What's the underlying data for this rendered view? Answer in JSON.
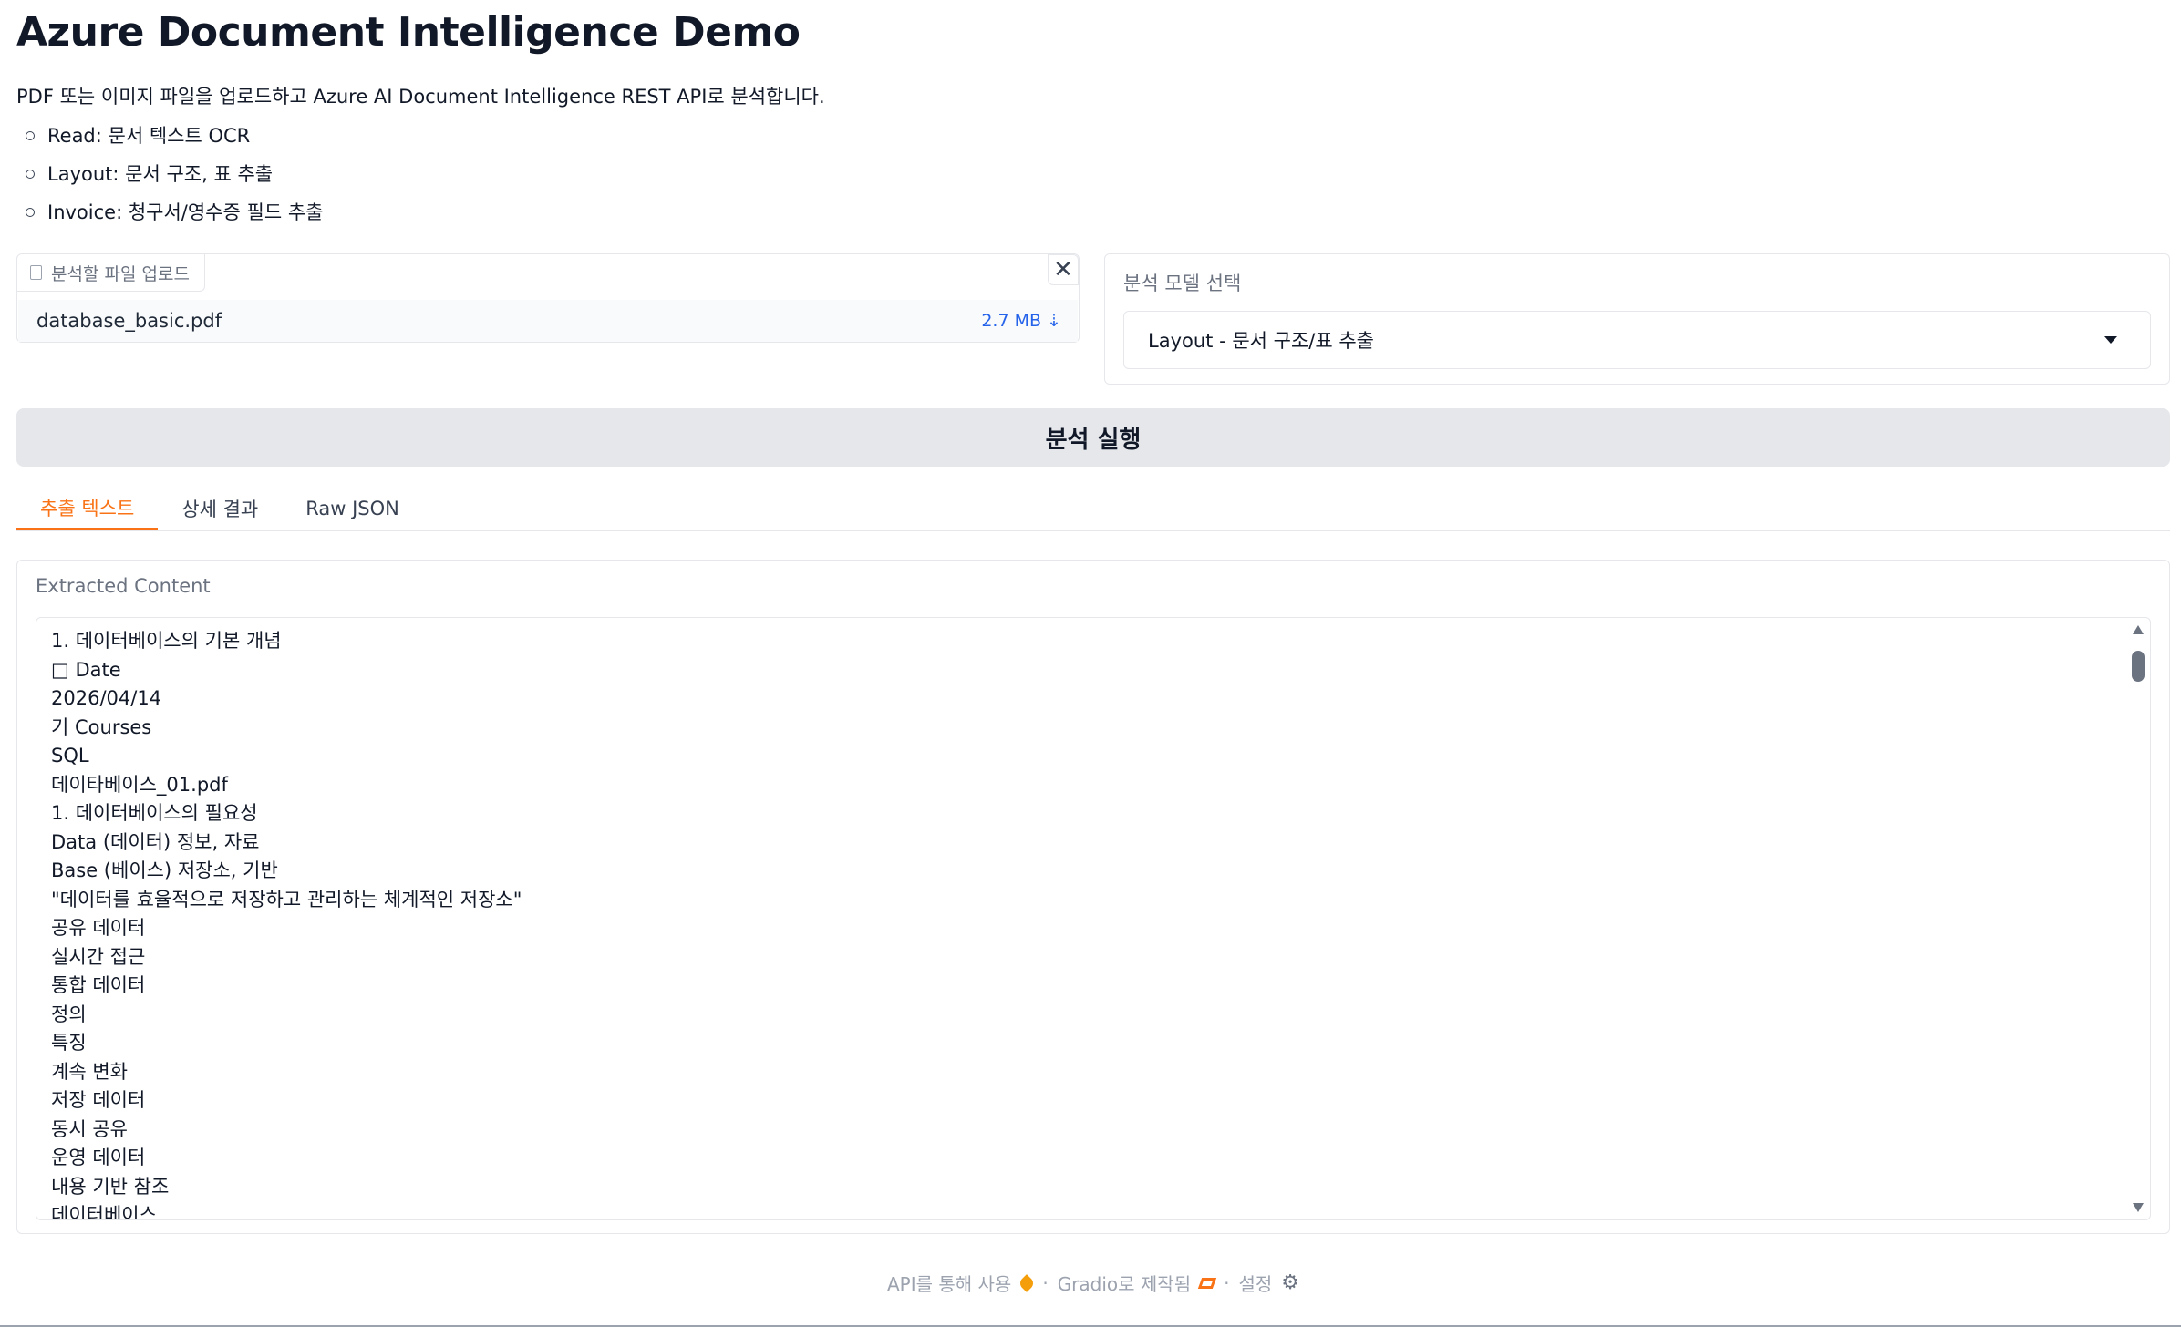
{
  "header": {
    "title": "Azure Document Intelligence Demo",
    "intro": "PDF 또는 이미지 파일을 업로드하고 Azure AI Document Intelligence REST API로 분석합니다.",
    "features": [
      "Read: 문서 텍스트 OCR",
      "Layout: 문서 구조, 표 추출",
      "Invoice: 청구서/영수증 필드 추출"
    ]
  },
  "upload": {
    "label": "분석할 파일 업로드",
    "close_symbol": "✕",
    "file_name": "database_basic.pdf",
    "file_size": "2.7 MB ⇣"
  },
  "model": {
    "label": "분석 모델 선택",
    "selected": "Layout - 문서 구조/표 추출"
  },
  "run_button": "분석 실행",
  "tabs": [
    {
      "label": "추출 텍스트",
      "active": true
    },
    {
      "label": "상세 결과",
      "active": false
    },
    {
      "label": "Raw JSON",
      "active": false
    }
  ],
  "content": {
    "label": "Extracted Content",
    "lines": [
      "1. 데이터베이스의 기본 개념",
      "□ Date",
      "2026/04/14",
      "기 Courses",
      "SQL",
      "데이타베이스_01.pdf",
      "1. 데이터베이스의 필요성",
      "Data (데이터) 정보, 자료",
      "Base (베이스) 저장소, 기반",
      "\"데이터를 효율적으로 저장하고 관리하는 체계적인 저장소\"",
      "공유 데이터",
      "실시간 접근",
      "통합 데이터",
      "정의",
      "특징",
      "계속 변화",
      "저장 데이터",
      "동시 공유",
      "운영 데이터",
      "내용 기반 참조",
      "데이터베이스"
    ]
  },
  "footer": {
    "api": "API를 통해 사용",
    "gradio": "Gradio로 제작됨",
    "settings": "설정",
    "sep": "·"
  }
}
